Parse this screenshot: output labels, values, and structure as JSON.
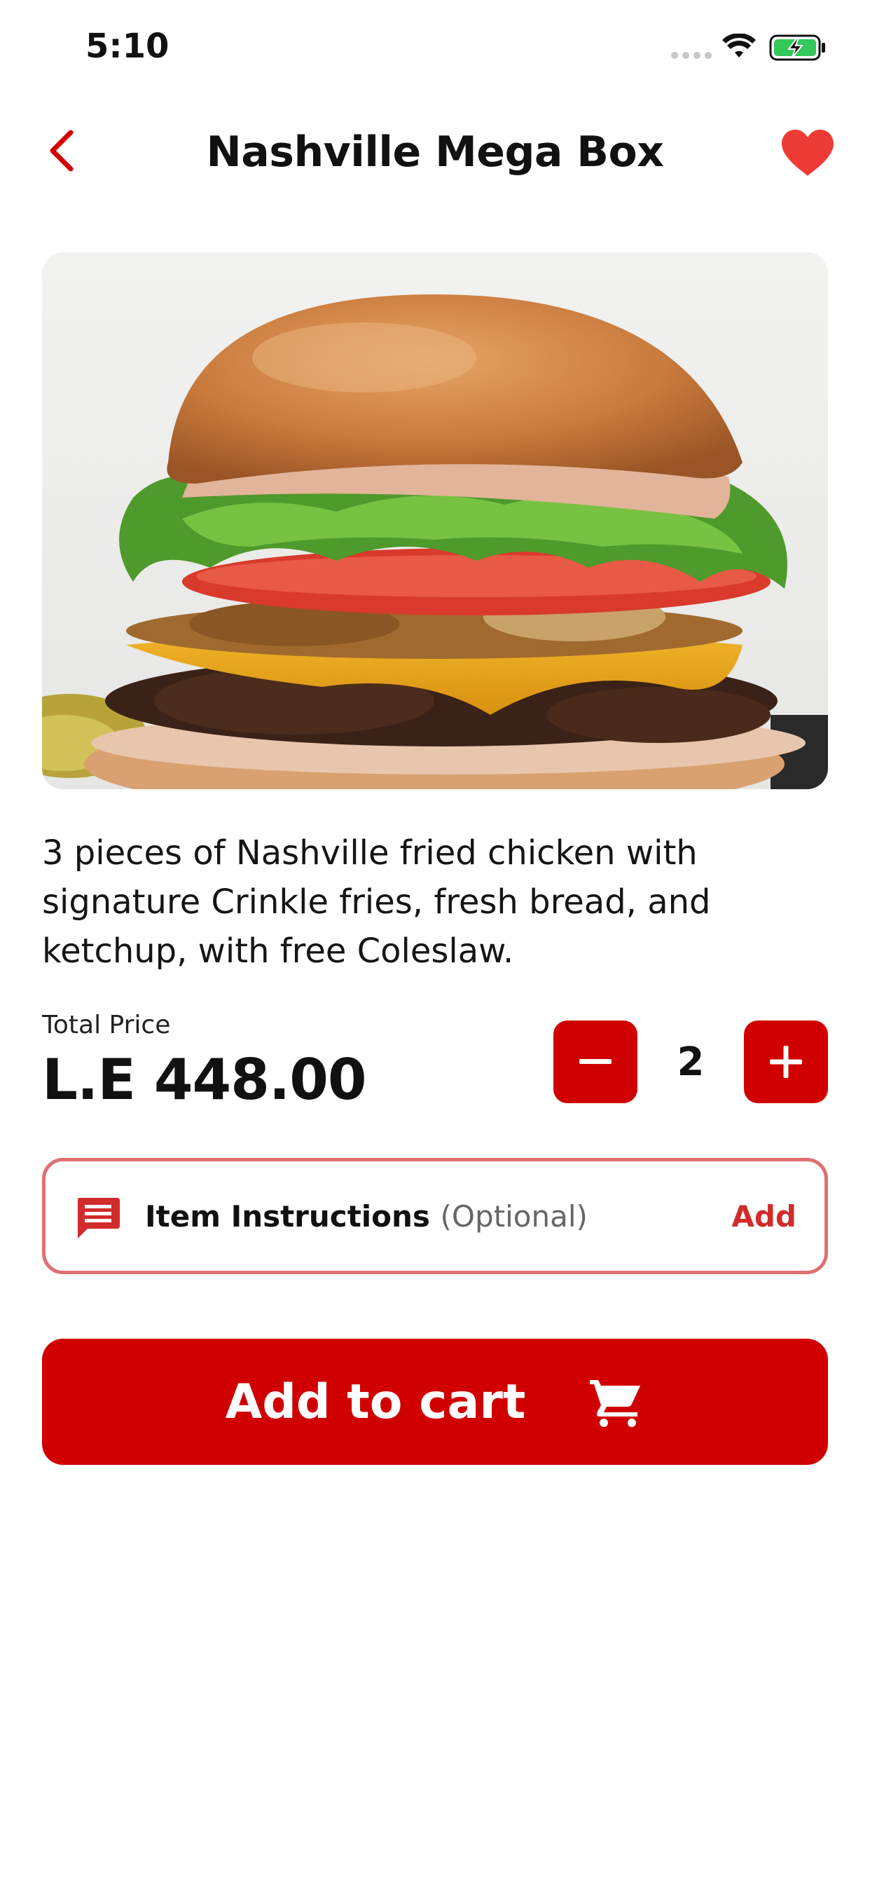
{
  "status_bar": {
    "time": "5:10"
  },
  "header": {
    "title": "Nashville Mega Box",
    "back_icon": "chevron-left-icon",
    "favorite_icon": "heart-icon"
  },
  "product": {
    "image": "burger-photo",
    "description": "3 pieces of Nashville fried chicken with signature Crinkle fries, fresh bread, and ketchup, with free Coleslaw."
  },
  "price": {
    "label": "Total Price",
    "value": "L.E 448.00"
  },
  "quantity": {
    "value": "2",
    "minus_icon": "minus-icon",
    "plus_icon": "plus-icon"
  },
  "instructions": {
    "icon": "message-icon",
    "label": "Item Instructions",
    "optional": "(Optional)",
    "action": "Add"
  },
  "cart_button": {
    "label": "Add to cart",
    "icon": "cart-icon"
  },
  "colors": {
    "accent": "#d10000",
    "favorite": "#ef3b36",
    "border": "#e07070",
    "add_link": "#d22b2b"
  }
}
